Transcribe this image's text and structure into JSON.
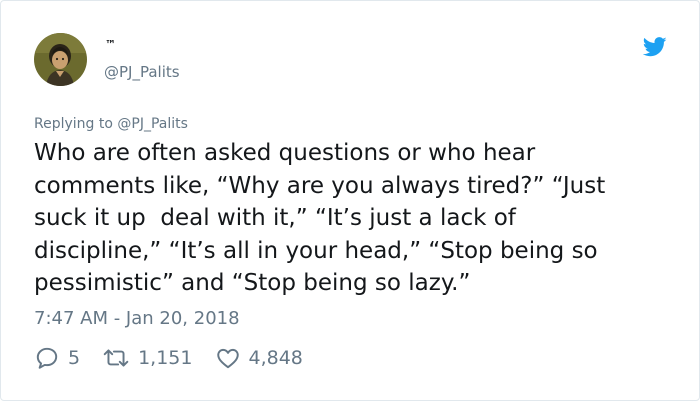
{
  "tweet": {
    "display_name": "™",
    "handle": "@PJ_Palits",
    "replying_prefix": "Replying to ",
    "replying_handle": "@PJ_Palits",
    "text": "Who are often asked questions or who hear\ncomments like, “Why are you always tired?” “Just\nsuck it up  deal with it,” “It’s just a lack of\ndiscipline,” “It’s all in your head,” “Stop being so\npessimistic” and “Stop being so lazy.”",
    "timestamp": "7:47 AM - Jan 20, 2018",
    "replies": "5",
    "retweets": "1,151",
    "likes": "4,848"
  },
  "icons": {
    "avatar": "avatar-portrait",
    "bird": "twitter-bird-icon",
    "reply": "reply-bubble-icon",
    "retweet": "retweet-icon",
    "like": "heart-icon"
  },
  "colors": {
    "text": "#14171a",
    "secondary": "#657786",
    "twitter_blue": "#1da1f2",
    "border": "#e1e8ed"
  }
}
